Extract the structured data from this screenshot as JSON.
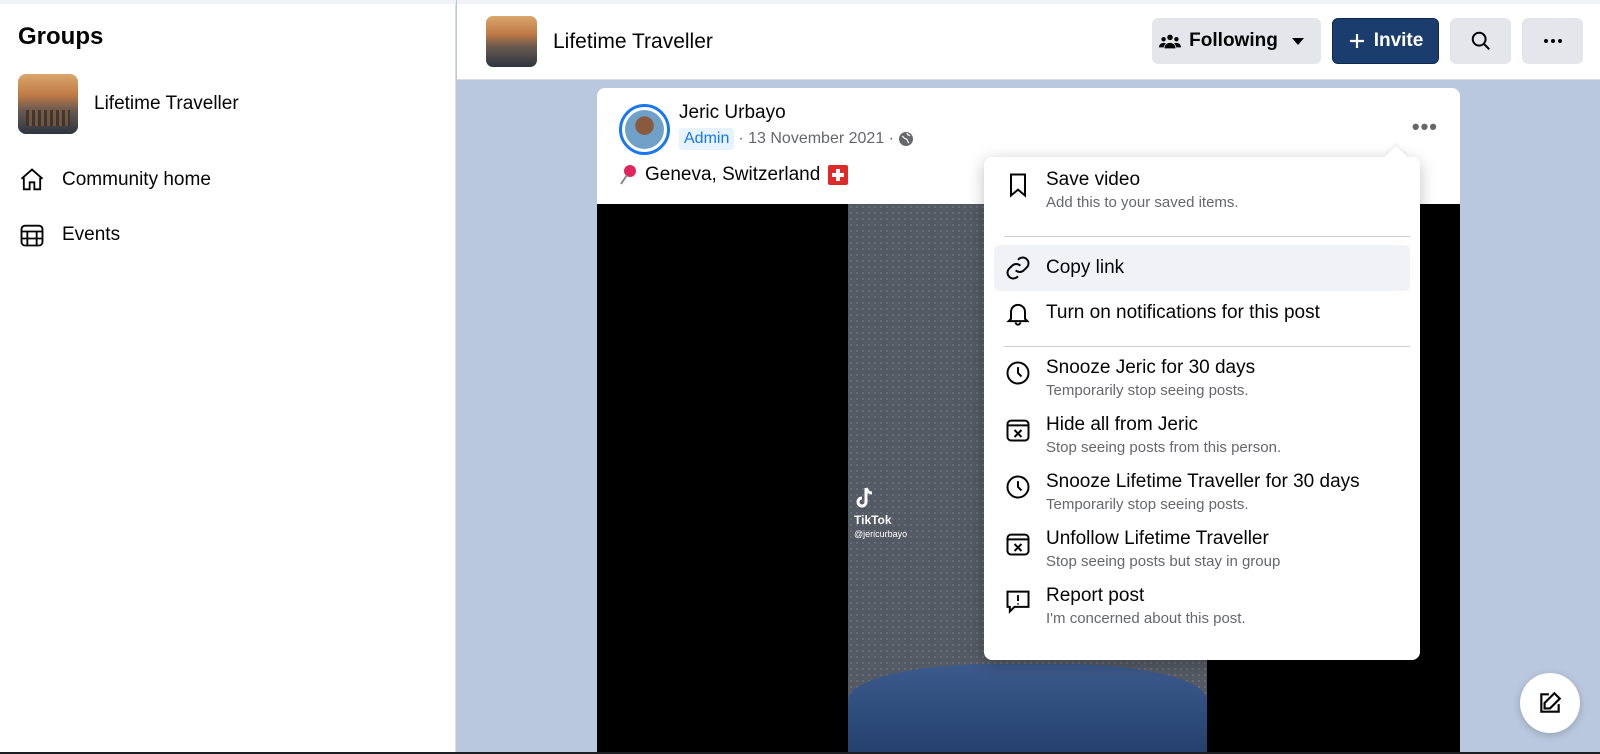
{
  "sidebar": {
    "title": "Groups",
    "group_name": "Lifetime Traveller",
    "nav": [
      {
        "label": "Community home",
        "icon": "home-icon"
      },
      {
        "label": "Events",
        "icon": "calendar-icon"
      }
    ]
  },
  "header": {
    "group_title": "Lifetime Traveller",
    "following_label": "Following",
    "invite_label": "Invite"
  },
  "post": {
    "author": "Jeric Urbayo",
    "badge": "Admin",
    "date": "· 13 November 2021 ·",
    "location": "Geneva, Switzerland",
    "video_watermark": "TikTok",
    "video_handle": "@jericurbayo"
  },
  "menu": {
    "items": [
      {
        "title": "Save video",
        "subtitle": "Add this to your saved items.",
        "icon": "bookmark-icon"
      },
      {
        "title": "Copy link",
        "subtitle": "",
        "icon": "link-icon"
      },
      {
        "title": "Turn on notifications for this post",
        "subtitle": "",
        "icon": "bell-icon"
      },
      {
        "title": "Snooze Jeric for 30 days",
        "subtitle": "Temporarily stop seeing posts.",
        "icon": "clock-icon"
      },
      {
        "title": "Hide all from Jeric",
        "subtitle": "Stop seeing posts from this person.",
        "icon": "hide-icon"
      },
      {
        "title": "Snooze Lifetime Traveller for 30 days",
        "subtitle": "Temporarily stop seeing posts.",
        "icon": "clock-icon"
      },
      {
        "title": "Unfollow Lifetime Traveller",
        "subtitle": "Stop seeing posts but stay in group",
        "icon": "unfollow-icon"
      },
      {
        "title": "Report post",
        "subtitle": "I'm concerned about this post.",
        "icon": "report-icon"
      }
    ]
  },
  "colors": {
    "invite_bg": "#1a3d6d",
    "page_bg": "#b9c8de",
    "admin_badge": "#1877f2"
  }
}
